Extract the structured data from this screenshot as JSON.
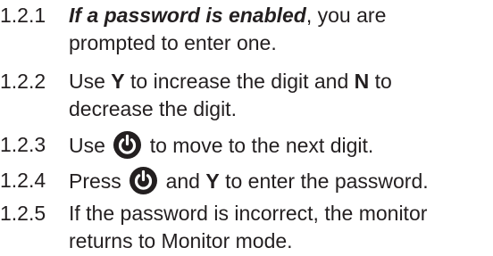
{
  "steps": [
    {
      "number": "1.2.1",
      "emphasis": "If a password is enabled",
      "text_after": ", you are",
      "continuation": "prompted to enter one."
    },
    {
      "number": "1.2.2",
      "text_before": "Use",
      "key_increase": "Y",
      "text_middle": "to increase the digit and",
      "key_decrease": "N",
      "text_after": "to",
      "continuation": "decrease the digit."
    },
    {
      "number": "1.2.3",
      "text_before": "Use",
      "icon": "power-button-icon",
      "text_after": "to move to the next digit."
    },
    {
      "number": "1.2.4",
      "text_before": "Press",
      "icon": "power-button-icon",
      "text_middle": "and",
      "key": "Y",
      "text_after": "to enter the password."
    },
    {
      "number": "1.2.5",
      "text": "If the password is incorrect, the monitor",
      "continuation": "returns to Monitor mode."
    }
  ],
  "colors": {
    "text": "#231f20",
    "icon_fill": "#231f20",
    "icon_symbol": "#ffffff"
  }
}
